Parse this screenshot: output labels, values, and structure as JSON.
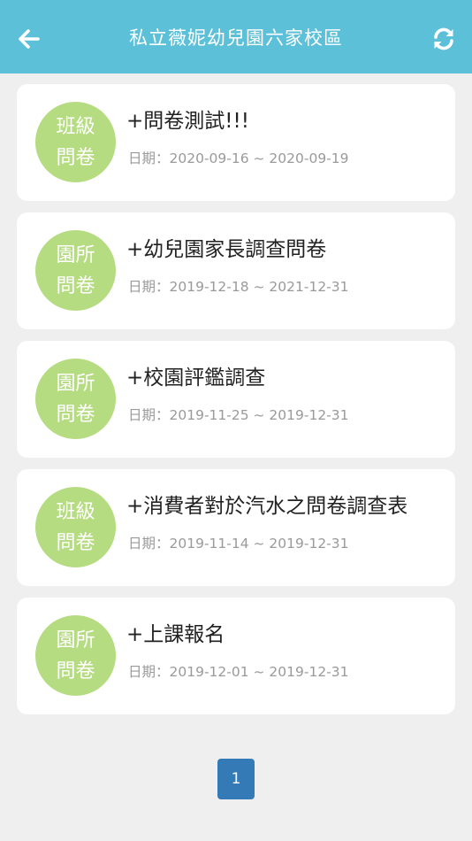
{
  "header": {
    "title": "私立薇妮幼兒園六家校區",
    "back_icon": "arrow-left-icon",
    "refresh_icon": "refresh-icon",
    "background": "#5bc0d8"
  },
  "surveys": [
    {
      "badge_line1": "班級",
      "badge_line2": "問卷",
      "title": "+問卷測試!!!",
      "date": "日期：2020-09-16 ~ 2020-09-19"
    },
    {
      "badge_line1": "園所",
      "badge_line2": "問卷",
      "title": "+幼兒園家長調查問卷",
      "date": "日期：2019-12-18 ~ 2021-12-31"
    },
    {
      "badge_line1": "園所",
      "badge_line2": "問卷",
      "title": "+校園評鑑調查",
      "date": "日期：2019-11-25 ~ 2019-12-31"
    },
    {
      "badge_line1": "班級",
      "badge_line2": "問卷",
      "title": "+消費者對於汽水之問卷調查表",
      "date": "日期：2019-11-14 ~ 2019-12-31"
    },
    {
      "badge_line1": "園所",
      "badge_line2": "問卷",
      "title": "+上課報名",
      "date": "日期：2019-12-01 ~ 2019-12-31"
    }
  ],
  "badge_color": "#b5dc80",
  "pagination": {
    "current_page": "1",
    "color": "#337ab7"
  }
}
